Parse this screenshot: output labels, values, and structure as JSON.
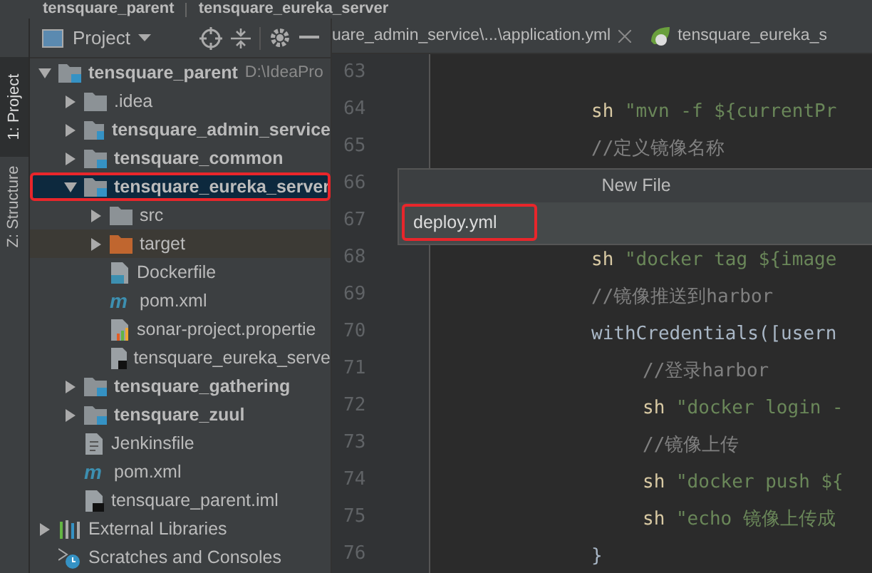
{
  "breadcrumb": [
    "tensquare_parent",
    "tensquare_eureka_server"
  ],
  "tool_strip": [
    {
      "label": "1: Project",
      "selected": true
    },
    {
      "label": "Z: Structure",
      "selected": false
    }
  ],
  "project_panel": {
    "title": "Project",
    "tree": [
      {
        "label": "tensquare_parent",
        "path_hint": "D:\\IdeaPro",
        "kind": "module",
        "bold": true,
        "expanded": true,
        "selected": false,
        "children": [
          {
            "label": ".idea",
            "kind": "folder",
            "bold": false,
            "expanded": false,
            "selected": false
          },
          {
            "label": "tensquare_admin_service",
            "kind": "module",
            "bold": true,
            "expanded": false,
            "selected": false
          },
          {
            "label": "tensquare_common",
            "kind": "module",
            "bold": true,
            "expanded": false,
            "selected": false
          },
          {
            "label": "tensquare_eureka_server",
            "kind": "module",
            "bold": true,
            "expanded": true,
            "selected": true,
            "children": [
              {
                "label": "src",
                "kind": "folder",
                "bold": false,
                "expanded": false,
                "selected": false
              },
              {
                "label": "target",
                "kind": "excluded",
                "bold": false,
                "expanded": false,
                "selected": false
              },
              {
                "label": "Dockerfile",
                "kind": "docker",
                "bold": false,
                "selected": false
              },
              {
                "label": "pom.xml",
                "kind": "maven",
                "icon": "m",
                "bold": false,
                "selected": false
              },
              {
                "label": "sonar-project.propertie",
                "kind": "sonar",
                "bold": false,
                "selected": false
              },
              {
                "label": "tensquare_eureka_serve",
                "kind": "iml",
                "bold": false,
                "selected": false
              }
            ]
          },
          {
            "label": "tensquare_gathering",
            "kind": "module",
            "bold": true,
            "expanded": false,
            "selected": false
          },
          {
            "label": "tensquare_zuul",
            "kind": "module",
            "bold": true,
            "expanded": false,
            "selected": false
          },
          {
            "label": "Jenkinsfile",
            "kind": "text",
            "bold": false,
            "selected": false
          },
          {
            "label": "pom.xml",
            "kind": "maven",
            "icon": "m",
            "bold": false,
            "selected": false
          },
          {
            "label": "tensquare_parent.iml",
            "kind": "iml",
            "bold": false,
            "selected": false
          }
        ]
      },
      {
        "label": "External Libraries",
        "kind": "libraries",
        "bold": false,
        "expanded": false,
        "selected": false
      },
      {
        "label": "Scratches and Consoles",
        "kind": "scratches",
        "bold": false,
        "selected": false
      }
    ]
  },
  "editor_tabs": [
    {
      "label": "uare_admin_service\\...\\application.yml",
      "closable": true,
      "selected": false
    },
    {
      "label": "tensquare_eureka_s",
      "closable": false,
      "selected": true
    }
  ],
  "code_lines": [
    {
      "number": "63"
    },
    {
      "number": "64",
      "tokens": [
        {
          "kind": "keyword",
          "text": "sh"
        },
        {
          "kind": "string",
          "text": " \"mvn -f ${currentPr"
        }
      ]
    },
    {
      "number": "65",
      "tokens": [
        {
          "kind": "comment",
          "text": "//定义镜像名称"
        }
      ]
    },
    {
      "number": "66"
    },
    {
      "number": "67"
    },
    {
      "number": "68",
      "tokens": [
        {
          "kind": "keyword",
          "text": "sh"
        },
        {
          "kind": "string",
          "text": " \"docker tag ${image"
        }
      ]
    },
    {
      "number": "69",
      "tokens": [
        {
          "kind": "comment",
          "text": "//镜像推送到harbor"
        }
      ]
    },
    {
      "number": "70",
      "tokens": [
        {
          "kind": "plain",
          "text": "withCredentials([usern"
        }
      ],
      "children": [
        {
          "number": "71",
          "tokens": [
            {
              "kind": "comment",
              "text": "//登录harbor"
            }
          ]
        },
        {
          "number": "72",
          "tokens": [
            {
              "kind": "keyword",
              "text": "sh"
            },
            {
              "kind": "string",
              "text": " \"docker login -"
            }
          ]
        },
        {
          "number": "73",
          "tokens": [
            {
              "kind": "comment",
              "text": "//镜像上传"
            }
          ]
        },
        {
          "number": "74",
          "tokens": [
            {
              "kind": "keyword",
              "text": "sh"
            },
            {
              "kind": "string",
              "text": " \"docker push ${"
            }
          ]
        },
        {
          "number": "75",
          "tokens": [
            {
              "kind": "keyword",
              "text": "sh"
            },
            {
              "kind": "string",
              "text": " \"echo 镜像上传成"
            }
          ]
        }
      ]
    },
    {
      "number": "76",
      "tokens": [
        {
          "kind": "plain",
          "text": "}"
        }
      ]
    }
  ],
  "new_file_popup": {
    "title": "New File",
    "value": "deploy.yml"
  }
}
